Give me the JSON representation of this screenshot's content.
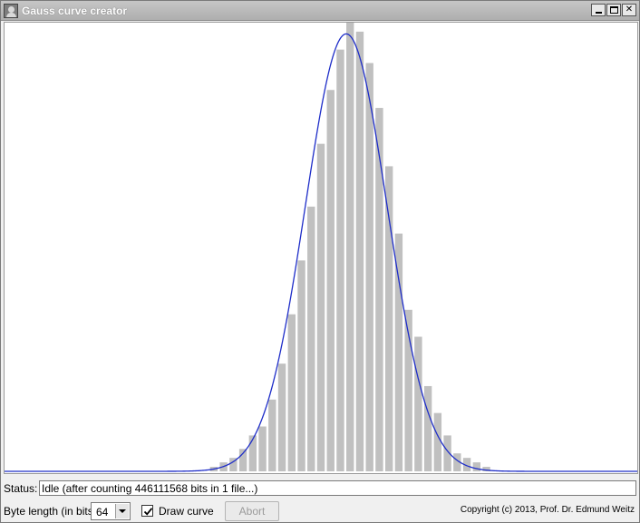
{
  "window": {
    "title": "Gauss curve creator"
  },
  "colors": {
    "bar": "#c0c0c0",
    "curve": "#1e2dc8",
    "plot_background": "#ffffff"
  },
  "icons": {
    "app": "person-portrait-icon",
    "minimize": "minimize-icon",
    "maximize": "maximize-icon",
    "close": "close-icon",
    "dropdown": "chevron-down-icon",
    "checkmark": "checkmark-icon"
  },
  "chart_data": {
    "type": "bar",
    "bin_count": 65,
    "values": [
      0,
      0,
      0,
      0,
      0,
      0,
      0,
      0,
      0,
      0,
      0,
      0,
      0,
      0,
      0,
      0,
      0,
      0,
      0,
      0,
      0,
      0.01,
      0.02,
      0.03,
      0.05,
      0.08,
      0.1,
      0.16,
      0.24,
      0.35,
      0.47,
      0.59,
      0.73,
      0.85,
      0.94,
      1.0,
      0.98,
      0.91,
      0.81,
      0.68,
      0.53,
      0.36,
      0.3,
      0.19,
      0.13,
      0.08,
      0.04,
      0.03,
      0.02,
      0.01,
      0,
      0,
      0,
      0,
      0,
      0,
      0,
      0,
      0,
      0,
      0,
      0,
      0,
      0,
      0
    ],
    "curve": {
      "mean_bin": 34.6,
      "sigma_bins": 4.2,
      "peak": 0.975
    },
    "title": "",
    "xlabel": "",
    "ylabel": ""
  },
  "status": {
    "label": "Status:",
    "text": "Idle (after counting 446111568 bits in 1 file...)"
  },
  "controls": {
    "byte_length_label": "Byte length (in bits):",
    "byte_length_value": "64",
    "draw_curve_label": "Draw curve",
    "draw_curve_checked": true,
    "abort_label": "Abort",
    "copyright": "Copyright (c) 2013, Prof. Dr. Edmund Weitz"
  }
}
